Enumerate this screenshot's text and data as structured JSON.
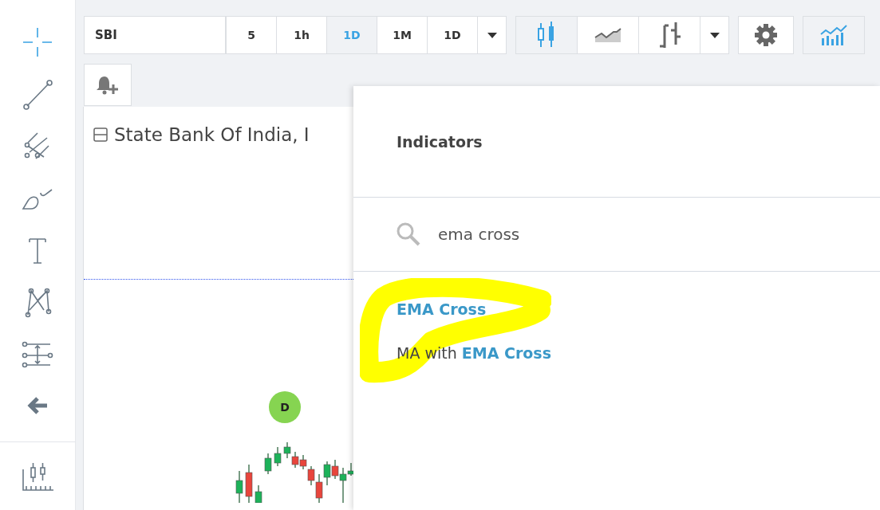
{
  "drawing_tools": [
    {
      "kind": "crosshair",
      "selected": true
    },
    {
      "kind": "trend-line",
      "selected": false
    },
    {
      "kind": "pitchfork",
      "selected": false
    },
    {
      "kind": "brush",
      "selected": false
    },
    {
      "kind": "text",
      "selected": false
    },
    {
      "kind": "pattern",
      "selected": false
    },
    {
      "kind": "measure",
      "selected": false
    },
    {
      "kind": "back",
      "selected": false
    }
  ],
  "bottom_tool": {
    "kind": "chart-template"
  },
  "toolbar": {
    "symbol": "SBI",
    "intervals": [
      {
        "label": "5",
        "selected": false
      },
      {
        "label": "1h",
        "selected": false
      },
      {
        "label": "1D",
        "selected": true
      },
      {
        "label": "1M",
        "selected": false
      },
      {
        "label": "1D",
        "selected": false
      }
    ],
    "chart_types": [
      {
        "kind": "candles",
        "selected": true
      },
      {
        "kind": "area",
        "selected": false
      },
      {
        "kind": "bars",
        "selected": false
      }
    ],
    "indicators_button": {
      "selected": true
    }
  },
  "chart": {
    "title": "State Bank Of India, I",
    "badge": "D"
  },
  "dialog": {
    "title": "Indicators",
    "search": {
      "value": "ema cross"
    },
    "results": [
      {
        "parts": [
          {
            "text": "EMA Cross",
            "match": true
          }
        ]
      },
      {
        "parts": [
          {
            "text": "MA with ",
            "match": false
          },
          {
            "text": "EMA Cross",
            "match": true
          }
        ]
      }
    ]
  }
}
